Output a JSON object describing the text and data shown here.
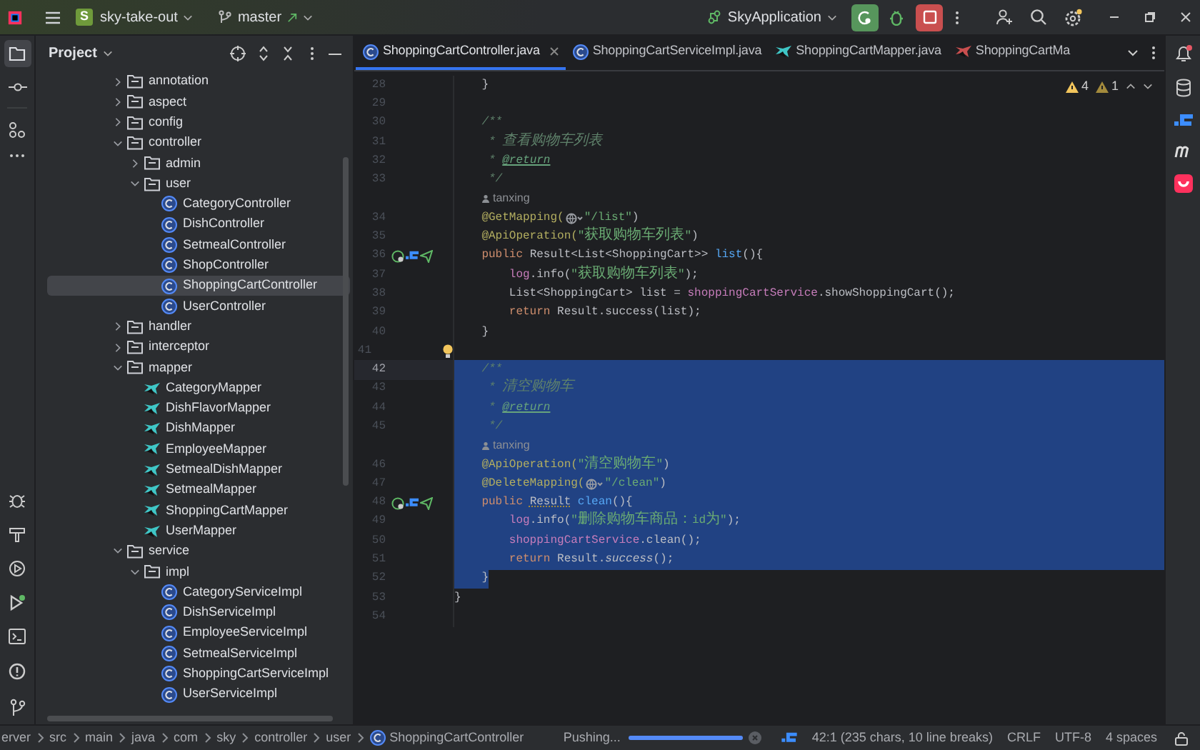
{
  "title_bar": {
    "project_badge": "S",
    "project": "sky-take-out",
    "branch": "master",
    "run_config": "SkyApplication"
  },
  "project_panel": {
    "title": "Project",
    "tree": [
      {
        "label": "annotation",
        "kind": "folder",
        "expanded": false,
        "selected": false
      },
      {
        "label": "aspect",
        "kind": "folder",
        "expanded": false,
        "selected": false
      },
      {
        "label": "config",
        "kind": "folder",
        "expanded": false,
        "selected": false
      },
      {
        "label": "controller",
        "kind": "folder",
        "expanded": true,
        "selected": false,
        "children": [
          {
            "label": "admin",
            "kind": "folder",
            "expanded": false,
            "selected": false
          },
          {
            "label": "user",
            "kind": "folder",
            "expanded": true,
            "selected": false,
            "children": [
              {
                "label": "CategoryController",
                "kind": "class",
                "selected": false
              },
              {
                "label": "DishController",
                "kind": "class",
                "selected": false
              },
              {
                "label": "SetmealController",
                "kind": "class",
                "selected": false
              },
              {
                "label": "ShopController",
                "kind": "class",
                "selected": false
              },
              {
                "label": "ShoppingCartController",
                "kind": "class",
                "selected": true
              },
              {
                "label": "UserController",
                "kind": "class",
                "selected": false
              }
            ]
          }
        ]
      },
      {
        "label": "handler",
        "kind": "folder",
        "expanded": false,
        "selected": false
      },
      {
        "label": "interceptor",
        "kind": "folder",
        "expanded": false,
        "selected": false
      },
      {
        "label": "mapper",
        "kind": "folder",
        "expanded": true,
        "selected": false,
        "children": [
          {
            "label": "CategoryMapper",
            "kind": "mapper",
            "selected": false
          },
          {
            "label": "DishFlavorMapper",
            "kind": "mapper",
            "selected": false
          },
          {
            "label": "DishMapper",
            "kind": "mapper",
            "selected": false
          },
          {
            "label": "EmployeeMapper",
            "kind": "mapper",
            "selected": false
          },
          {
            "label": "SetmealDishMapper",
            "kind": "mapper",
            "selected": false
          },
          {
            "label": "SetmealMapper",
            "kind": "mapper",
            "selected": false
          },
          {
            "label": "ShoppingCartMapper",
            "kind": "mapper",
            "selected": false
          },
          {
            "label": "UserMapper",
            "kind": "mapper",
            "selected": false
          }
        ]
      },
      {
        "label": "service",
        "kind": "folder",
        "expanded": true,
        "selected": false,
        "children": [
          {
            "label": "impl",
            "kind": "folder",
            "expanded": true,
            "selected": false,
            "children": [
              {
                "label": "CategoryServiceImpl",
                "kind": "class",
                "selected": false
              },
              {
                "label": "DishServiceImpl",
                "kind": "class",
                "selected": false
              },
              {
                "label": "EmployeeServiceImpl",
                "kind": "class",
                "selected": false
              },
              {
                "label": "SetmealServiceImpl",
                "kind": "class",
                "selected": false
              },
              {
                "label": "ShoppingCartServiceImpl",
                "kind": "class",
                "selected": false
              },
              {
                "label": "UserServiceImpl",
                "kind": "class",
                "selected": false
              }
            ]
          }
        ]
      }
    ]
  },
  "tabs": [
    {
      "label": "ShoppingCartController.java",
      "kind": "class",
      "selected": true
    },
    {
      "label": "ShoppingCartServiceImpl.java",
      "kind": "class",
      "selected": false
    },
    {
      "label": "ShoppingCartMapper.java",
      "kind": "mapper",
      "selected": false
    },
    {
      "label": "ShoppingCartMa",
      "kind": "xml",
      "selected": false
    }
  ],
  "inspections": {
    "warnings": "4",
    "weak_warnings": "1"
  },
  "code_lines": [
    {
      "number": "28",
      "selected": false,
      "current": false,
      "tokens": [
        {
          "kind": "plain",
          "text": "    }"
        }
      ]
    },
    {
      "number": "29",
      "selected": false,
      "current": false
    },
    {
      "number": "30",
      "selected": false,
      "current": false,
      "tokens": [
        {
          "kind": "comment",
          "text": "    /**"
        }
      ]
    },
    {
      "number": "31",
      "selected": false,
      "current": false,
      "tokens": [
        {
          "kind": "comment",
          "text": "     * 查看购物车列表"
        }
      ]
    },
    {
      "number": "32",
      "selected": false,
      "current": false,
      "tokens": [
        {
          "kind": "comment",
          "text": "     * "
        },
        {
          "kind": "doctag",
          "text": "@return"
        }
      ]
    },
    {
      "number": "33",
      "selected": false,
      "current": false,
      "tokens": [
        {
          "kind": "comment",
          "text": "     */"
        }
      ]
    },
    {
      "kind": "author",
      "selected": false,
      "current": false,
      "text": "tanxing"
    },
    {
      "number": "34",
      "selected": false,
      "current": false,
      "tokens": [
        {
          "kind": "annotation",
          "text": "    @GetMapping("
        },
        {
          "kind": "globe"
        },
        {
          "kind": "string",
          "text": "\"/list\""
        },
        {
          "kind": "plain",
          "text": ")"
        }
      ]
    },
    {
      "number": "35",
      "selected": false,
      "current": false,
      "tokens": [
        {
          "kind": "annotation",
          "text": "    @ApiOperation("
        },
        {
          "kind": "string",
          "text": "\"获取购物车列表\""
        },
        {
          "kind": "plain",
          "text": ")"
        }
      ]
    },
    {
      "number": "36",
      "kind": "endpoint",
      "selected": false,
      "current": false,
      "tokens": [
        {
          "kind": "keyword",
          "text": "    public "
        },
        {
          "kind": "plain",
          "text": "Result<List<ShoppingCart>> "
        },
        {
          "kind": "method",
          "text": "list"
        },
        {
          "kind": "plain",
          "text": "(){"
        }
      ]
    },
    {
      "number": "37",
      "selected": false,
      "current": false,
      "tokens": [
        {
          "kind": "field",
          "text": "        log"
        },
        {
          "kind": "plain",
          "text": ".info("
        },
        {
          "kind": "string",
          "text": "\"获取购物车列表\""
        },
        {
          "kind": "plain",
          "text": ");"
        }
      ]
    },
    {
      "number": "38",
      "selected": false,
      "current": false,
      "tokens": [
        {
          "kind": "plain",
          "text": "        List<ShoppingCart> list = "
        },
        {
          "kind": "field",
          "text": "shoppingCartService"
        },
        {
          "kind": "plain",
          "text": ".showShoppingCart();"
        }
      ]
    },
    {
      "number": "39",
      "selected": false,
      "current": false,
      "tokens": [
        {
          "kind": "keyword",
          "text": "        return "
        },
        {
          "kind": "plain",
          "text": "Result.success(list);"
        }
      ]
    },
    {
      "number": "40",
      "selected": false,
      "current": false,
      "tokens": [
        {
          "kind": "plain",
          "text": "    }"
        }
      ]
    },
    {
      "number": "41",
      "kind": "bulb",
      "selected": false,
      "current": false
    },
    {
      "number": "42",
      "selected": true,
      "current": true,
      "tokens": [
        {
          "kind": "comment",
          "text": "    /**"
        }
      ]
    },
    {
      "number": "43",
      "selected": true,
      "current": false,
      "tokens": [
        {
          "kind": "comment",
          "text": "     * 清空购物车"
        }
      ]
    },
    {
      "number": "44",
      "selected": true,
      "current": false,
      "tokens": [
        {
          "kind": "comment",
          "text": "     * "
        },
        {
          "kind": "doctag",
          "text": "@return"
        }
      ]
    },
    {
      "number": "45",
      "selected": true,
      "current": false,
      "tokens": [
        {
          "kind": "comment",
          "text": "     */"
        }
      ]
    },
    {
      "kind": "author",
      "selected": true,
      "current": false,
      "text": "tanxing"
    },
    {
      "number": "46",
      "selected": true,
      "current": false,
      "tokens": [
        {
          "kind": "annotation",
          "text": "    @ApiOperation("
        },
        {
          "kind": "string",
          "text": "\"清空购物车\""
        },
        {
          "kind": "plain",
          "text": ")"
        }
      ]
    },
    {
      "number": "47",
      "selected": true,
      "current": false,
      "tokens": [
        {
          "kind": "annotation",
          "text": "    @DeleteMapping("
        },
        {
          "kind": "globe"
        },
        {
          "kind": "string",
          "text": "\"/clean\""
        },
        {
          "kind": "plain",
          "text": ")"
        }
      ]
    },
    {
      "number": "48",
      "kind": "endpoint",
      "selected": true,
      "current": false,
      "tokens": [
        {
          "kind": "keyword",
          "text": "    public "
        },
        {
          "kind": "warned",
          "text": "Result"
        },
        {
          "kind": "method",
          "text": " clean"
        },
        {
          "kind": "plain",
          "text": "(){"
        }
      ]
    },
    {
      "number": "49",
      "selected": true,
      "current": false,
      "tokens": [
        {
          "kind": "field",
          "text": "        log"
        },
        {
          "kind": "plain",
          "text": ".info("
        },
        {
          "kind": "string",
          "text": "\"删除购物车商品：id为\""
        },
        {
          "kind": "plain",
          "text": ");"
        }
      ]
    },
    {
      "number": "50",
      "selected": true,
      "current": false,
      "tokens": [
        {
          "kind": "field",
          "text": "        shoppingCartService"
        },
        {
          "kind": "plain",
          "text": ".clean();"
        }
      ]
    },
    {
      "number": "51",
      "selected": true,
      "current": false,
      "tokens": [
        {
          "kind": "keyword",
          "text": "        return "
        },
        {
          "kind": "plain",
          "text": "Result."
        },
        {
          "kind": "static",
          "text": "success"
        },
        {
          "kind": "plain",
          "text": "();"
        }
      ]
    },
    {
      "number": "52",
      "selected": true,
      "current": false,
      "tokens": [
        {
          "kind": "plain",
          "text": "    }"
        }
      ]
    },
    {
      "number": "53",
      "selected": false,
      "current": false,
      "tokens": [
        {
          "kind": "plain",
          "text": "}"
        }
      ]
    },
    {
      "number": "54",
      "selected": false,
      "current": false
    }
  ],
  "status_bar": {
    "breadcrumbs": [
      {
        "label": "erver",
        "kind": "folder"
      },
      {
        "label": "src",
        "kind": "folder"
      },
      {
        "label": "main",
        "kind": "folder"
      },
      {
        "label": "java",
        "kind": "folder"
      },
      {
        "label": "com",
        "kind": "folder"
      },
      {
        "label": "sky",
        "kind": "folder"
      },
      {
        "label": "controller",
        "kind": "folder"
      },
      {
        "label": "user",
        "kind": "folder"
      },
      {
        "label": "ShoppingCartController",
        "kind": "class"
      }
    ],
    "task": {
      "label": "Pushing...",
      "level": 1
    },
    "position": "42:1 (235 chars, 10 line breaks)",
    "line_ending": "CRLF",
    "encoding": "UTF-8",
    "indent": "4 spaces"
  }
}
